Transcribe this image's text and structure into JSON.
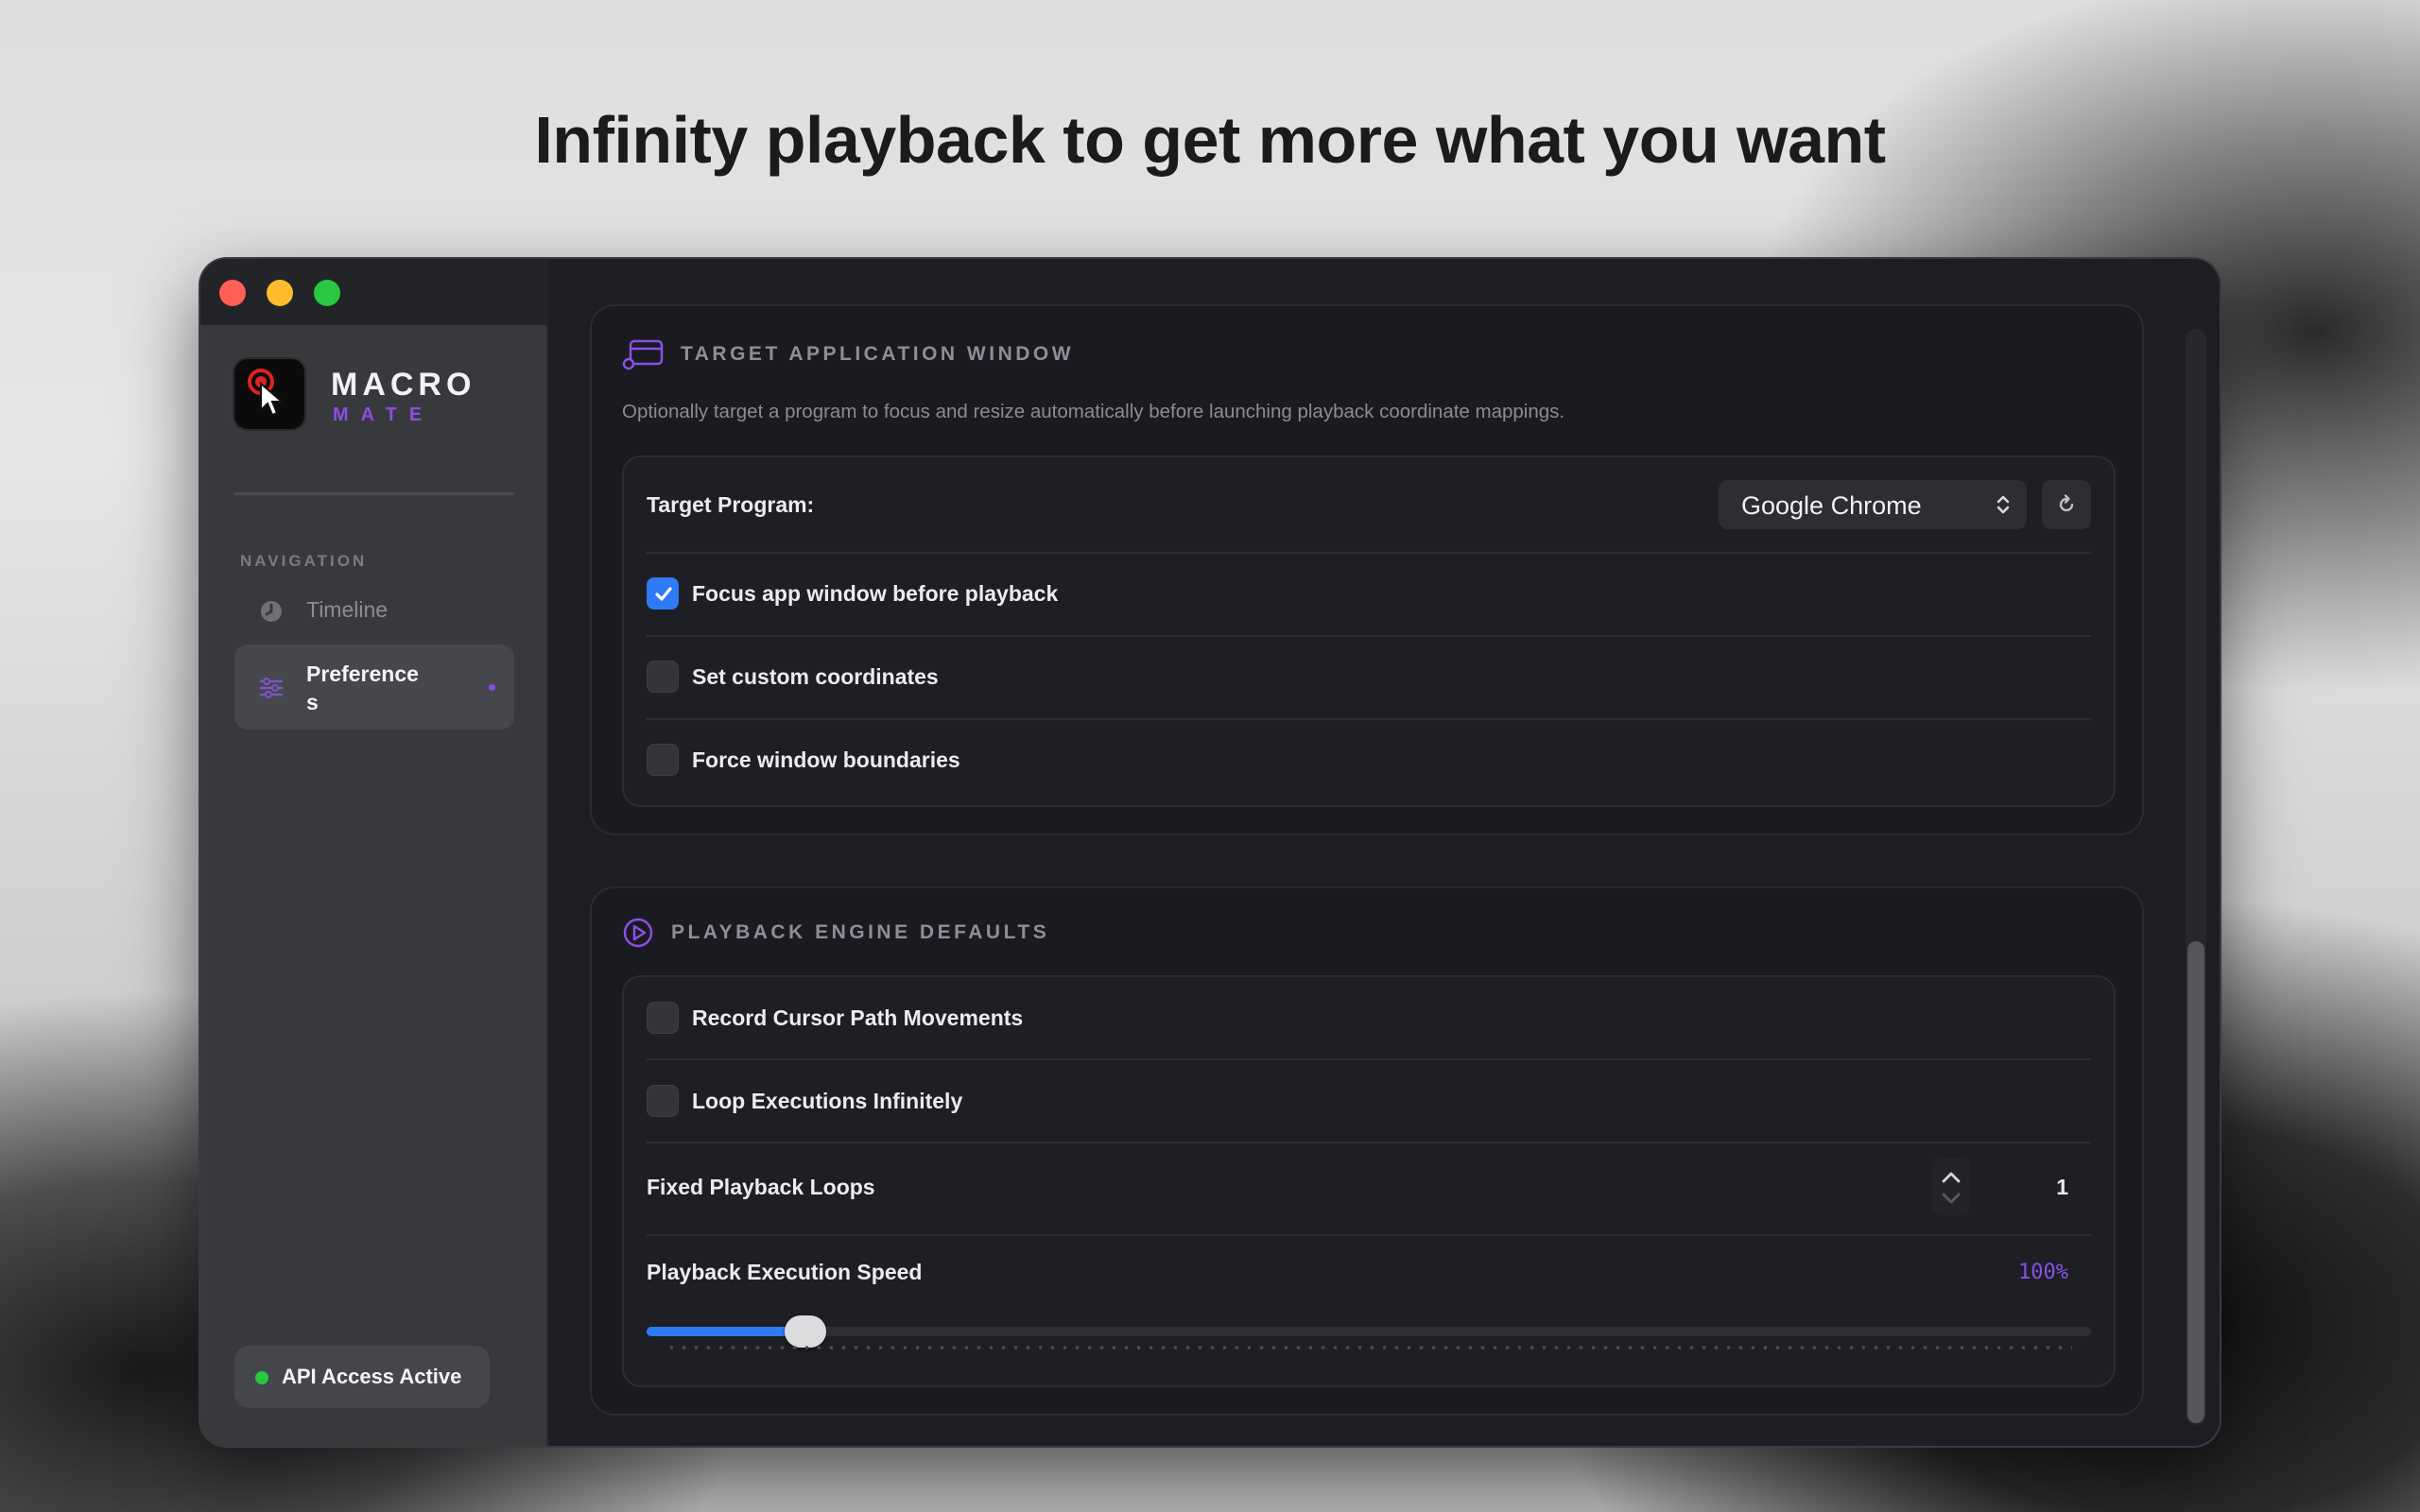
{
  "headline": "Infinity playback to get more what you want",
  "sidebar": {
    "brand_top": "MACRO",
    "brand_bottom": "MATE",
    "nav_label": "NAVIGATION",
    "items": [
      {
        "label": "Timeline",
        "icon": "clock-icon",
        "active": false
      },
      {
        "label": "Preferences",
        "icon": "sliders-icon",
        "active": true
      }
    ],
    "api_status": "API Access Active",
    "api_status_color": "#28c840"
  },
  "target_section": {
    "title": "TARGET APPLICATION WINDOW",
    "icon": "window-target-icon",
    "description": "Optionally target a program to focus and resize automatically before launching playback coordinate mappings.",
    "program_label": "Target Program:",
    "program_value": "Google Chrome",
    "options": [
      {
        "label": "Focus app window before playback",
        "checked": true
      },
      {
        "label": "Set custom coordinates",
        "checked": false
      },
      {
        "label": "Force window boundaries",
        "checked": false
      }
    ]
  },
  "engine_section": {
    "title": "PLAYBACK ENGINE DEFAULTS",
    "icon": "play-circle-icon",
    "options": [
      {
        "label": "Record Cursor Path Movements",
        "checked": false
      },
      {
        "label": "Loop Executions Infinitely",
        "checked": false
      }
    ],
    "loops_label": "Fixed Playback Loops",
    "loops_value": "1",
    "speed_label": "Playback Execution Speed",
    "speed_value": "100%",
    "speed_fraction": 0.11
  },
  "colors": {
    "accent": "#8a4fe6",
    "checkbox_on": "#2f7bf6",
    "close": "#fe5f57",
    "minimize": "#febc2e",
    "zoom": "#28c840"
  }
}
